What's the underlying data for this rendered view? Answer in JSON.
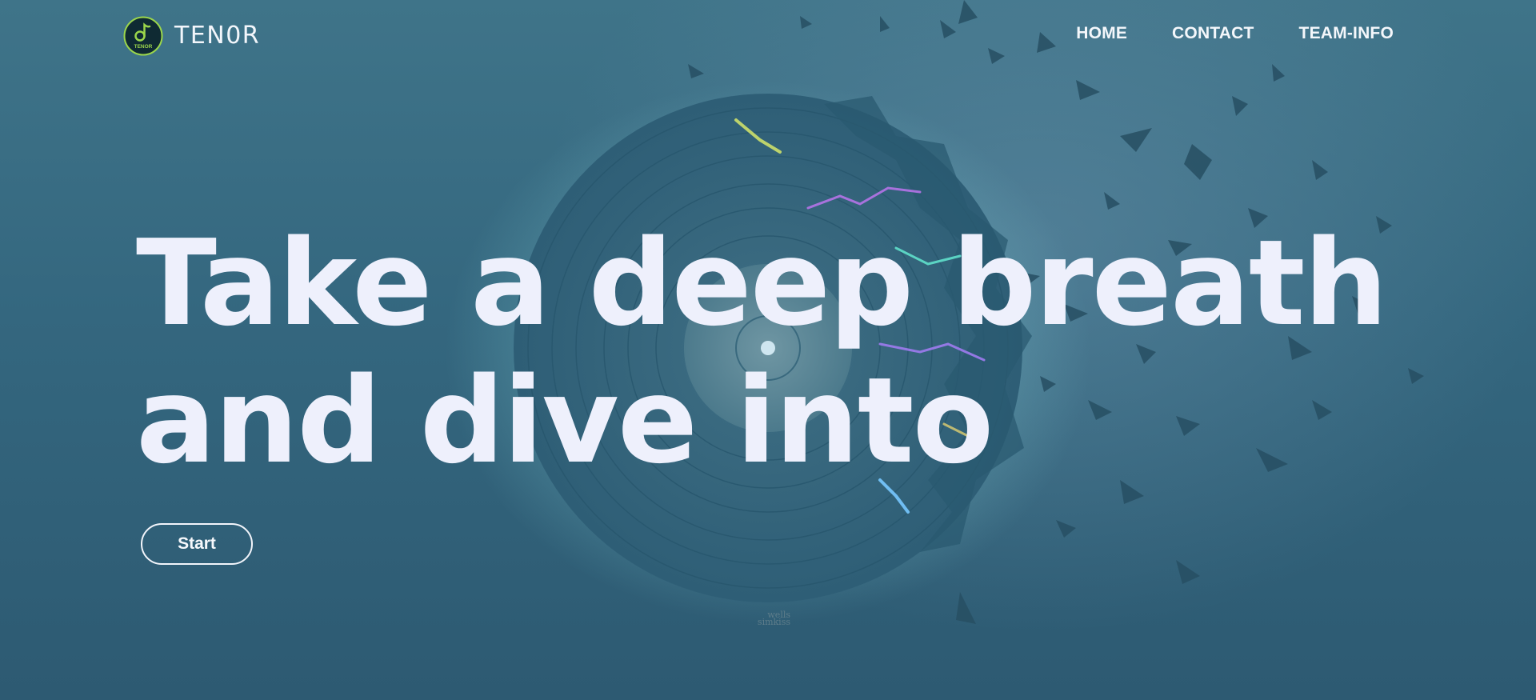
{
  "brand": {
    "name": "TEN0R",
    "logo_text": "TENOR",
    "logo_icon": "music-note-icon"
  },
  "nav": {
    "items": [
      {
        "label": "HOME"
      },
      {
        "label": "CONTACT"
      },
      {
        "label": "TEAM-INFO"
      }
    ]
  },
  "hero": {
    "title_line1": "Take a deep breath",
    "title_line2": "and dive into",
    "start_label": "Start",
    "art_signature_line1": "wells",
    "art_signature_line2": "simkiss"
  },
  "colors": {
    "background": "#34677f",
    "title_text": "#eef0fc",
    "logo_accent": "#9bd64b"
  }
}
